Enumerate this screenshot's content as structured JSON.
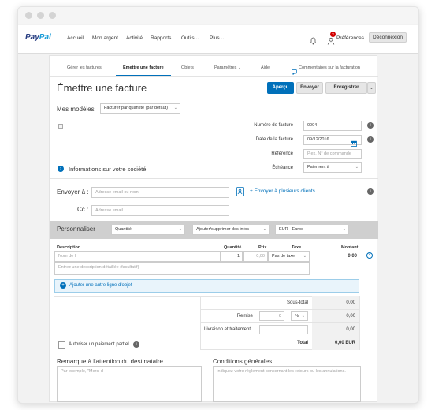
{
  "nav": {
    "logo_a": "Pay",
    "logo_b": "Pal",
    "items": [
      "Accueil",
      "Mon argent",
      "Activité",
      "Rapports",
      "Outils",
      "Plus"
    ],
    "notification_count": "2",
    "preferences": "Préférences",
    "logout": "Déconnexion"
  },
  "tabs": [
    "Gérer les factures",
    "Émettre une facture",
    "Objets",
    "Paramètres",
    "Aide",
    "Commentaires sur la facturation"
  ],
  "header": {
    "title": "Émettre une facture",
    "preview": "Aperçu",
    "send": "Envoyer",
    "save": "Enregistrer"
  },
  "templates": {
    "label": "Mes modèles",
    "selected": "Facturer par quantité (par défaut)"
  },
  "invoice_meta": {
    "number_label": "Numéro de facture",
    "number_value": "0004",
    "date_label": "Date de la facture",
    "date_value": "09/12/2016",
    "reference_label": "Référence",
    "reference_placeholder": "P.ex. N° de commande",
    "due_label": "Échéance",
    "due_value": "Paiement à"
  },
  "company_info": "Informations sur votre société",
  "recipient": {
    "to_label": "Envoyer à :",
    "to_placeholder": "Adresse email ou nom",
    "multi": "+ Envoyer à plusieurs clients",
    "cc_label": "Cc :",
    "cc_placeholder": "Adresse email"
  },
  "customize": {
    "label": "Personnaliser",
    "quantity": "Quantité",
    "add_remove": "Ajouter/supprimer des infos",
    "currency": "EUR - Euros"
  },
  "items_table": {
    "headers": [
      "Description",
      "Quantité",
      "Prix",
      "Taxe",
      "Montant"
    ],
    "name_placeholder": "Nom de l",
    "qty_value": "1",
    "price_placeholder": "0,00",
    "tax_value": "Pas de taxe",
    "amount_value": "0,00",
    "desc_placeholder": "Entrez une description détaillée (facultatif)",
    "add_line": "Ajouter une autre ligne d'objet"
  },
  "totals": {
    "subtotal_label": "Sous-total",
    "subtotal_value": "0,00",
    "discount_label": "Remise",
    "discount_input": "0",
    "discount_unit": "%",
    "discount_value": "0,00",
    "shipping_label": "Livraison et traitement",
    "shipping_value": "0,00",
    "total_label": "Total",
    "total_value": "0,00 EUR"
  },
  "partial_payment": "Autoriser un paiement partiel",
  "notes": {
    "recipient_title": "Remarque à l'attention du destinataire",
    "recipient_placeholder": "Par exemple, \"Merci d",
    "terms_title": "Conditions générales",
    "terms_placeholder": "Indiquez votre règlement concernant les retours ou les annulations."
  },
  "colors": {
    "primary": "#0070ba",
    "logo_dark": "#253b80",
    "logo_light": "#179bd7"
  }
}
